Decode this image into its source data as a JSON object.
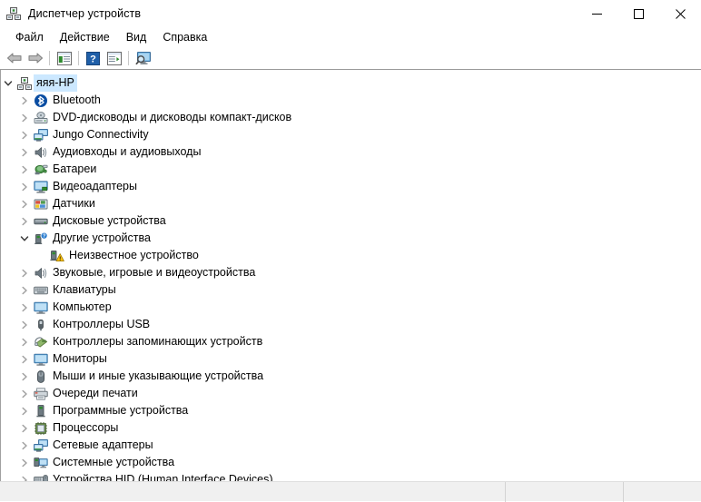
{
  "window": {
    "title": "Диспетчер устройств",
    "icon": "device-manager-icon",
    "minimize_label": "Свернуть",
    "maximize_label": "Развернуть",
    "close_label": "Закрыть"
  },
  "menubar": {
    "items": [
      {
        "label": "Файл",
        "name": "menu-file"
      },
      {
        "label": "Действие",
        "name": "menu-action"
      },
      {
        "label": "Вид",
        "name": "menu-view"
      },
      {
        "label": "Справка",
        "name": "menu-help"
      }
    ]
  },
  "toolbar": {
    "buttons": [
      {
        "icon": "back-arrow-icon",
        "label": "Назад"
      },
      {
        "icon": "forward-arrow-icon",
        "label": "Вперёд"
      },
      {
        "icon": "properties-icon",
        "label": "Свойства"
      },
      {
        "icon": "help-icon",
        "label": "Справка"
      },
      {
        "icon": "update-driver-icon",
        "label": "Обновить конфигурацию оборудования"
      },
      {
        "icon": "scan-hardware-icon",
        "label": "Показать скрытые устройства"
      }
    ]
  },
  "tree": {
    "root": {
      "label": "яяя-HP",
      "icon": "computer-root-icon",
      "expanded": true,
      "selected": true
    },
    "items": [
      {
        "label": "Bluetooth",
        "icon": "bluetooth-icon",
        "expanded": false,
        "indent": 1
      },
      {
        "label": "DVD-дисководы и дисководы компакт-дисков",
        "icon": "dvd-drive-icon",
        "expanded": false,
        "indent": 1
      },
      {
        "label": "Jungo Connectivity",
        "icon": "network-adapter-icon",
        "expanded": false,
        "indent": 1
      },
      {
        "label": "Аудиовходы и аудиовыходы",
        "icon": "audio-icon",
        "expanded": false,
        "indent": 1
      },
      {
        "label": "Батареи",
        "icon": "battery-icon",
        "expanded": false,
        "indent": 1
      },
      {
        "label": "Видеоадаптеры",
        "icon": "display-adapter-icon",
        "expanded": false,
        "indent": 1
      },
      {
        "label": "Датчики",
        "icon": "sensor-icon",
        "expanded": false,
        "indent": 1
      },
      {
        "label": "Дисковые устройства",
        "icon": "disk-drive-icon",
        "expanded": false,
        "indent": 1
      },
      {
        "label": "Другие устройства",
        "icon": "other-devices-icon",
        "expanded": true,
        "indent": 1
      },
      {
        "label": "Неизвестное устройство",
        "icon": "unknown-device-warning-icon",
        "expanded": null,
        "indent": 2
      },
      {
        "label": "Звуковые, игровые и видеоустройства",
        "icon": "audio-icon",
        "expanded": false,
        "indent": 1
      },
      {
        "label": "Клавиатуры",
        "icon": "keyboard-icon",
        "expanded": false,
        "indent": 1
      },
      {
        "label": "Компьютер",
        "icon": "monitor-icon",
        "expanded": false,
        "indent": 1
      },
      {
        "label": "Контроллеры USB",
        "icon": "usb-icon",
        "expanded": false,
        "indent": 1
      },
      {
        "label": "Контроллеры запоминающих устройств",
        "icon": "storage-controller-icon",
        "expanded": false,
        "indent": 1
      },
      {
        "label": "Мониторы",
        "icon": "monitor-icon",
        "expanded": false,
        "indent": 1
      },
      {
        "label": "Мыши и иные указывающие устройства",
        "icon": "mouse-icon",
        "expanded": false,
        "indent": 1
      },
      {
        "label": "Очереди печати",
        "icon": "printer-icon",
        "expanded": false,
        "indent": 1
      },
      {
        "label": "Программные устройства",
        "icon": "software-device-icon",
        "expanded": false,
        "indent": 1
      },
      {
        "label": "Процессоры",
        "icon": "processor-icon",
        "expanded": false,
        "indent": 1
      },
      {
        "label": "Сетевые адаптеры",
        "icon": "network-adapter-icon",
        "expanded": false,
        "indent": 1
      },
      {
        "label": "Системные устройства",
        "icon": "system-device-icon",
        "expanded": false,
        "indent": 1
      },
      {
        "label": "Устройства HID (Human Interface Devices)",
        "icon": "hid-device-icon",
        "expanded": false,
        "indent": 1
      }
    ]
  },
  "statusbar": {
    "segment1": "",
    "segment2": "",
    "segment3": ""
  },
  "colors": {
    "selection": "#cce8ff",
    "accent_blue": "#0078d7",
    "icon_blue": "#4a90d9",
    "warning_yellow": "#ffc20e",
    "chevron_gray": "#a0a0a0",
    "chevron_dark": "#3c3c3c"
  }
}
